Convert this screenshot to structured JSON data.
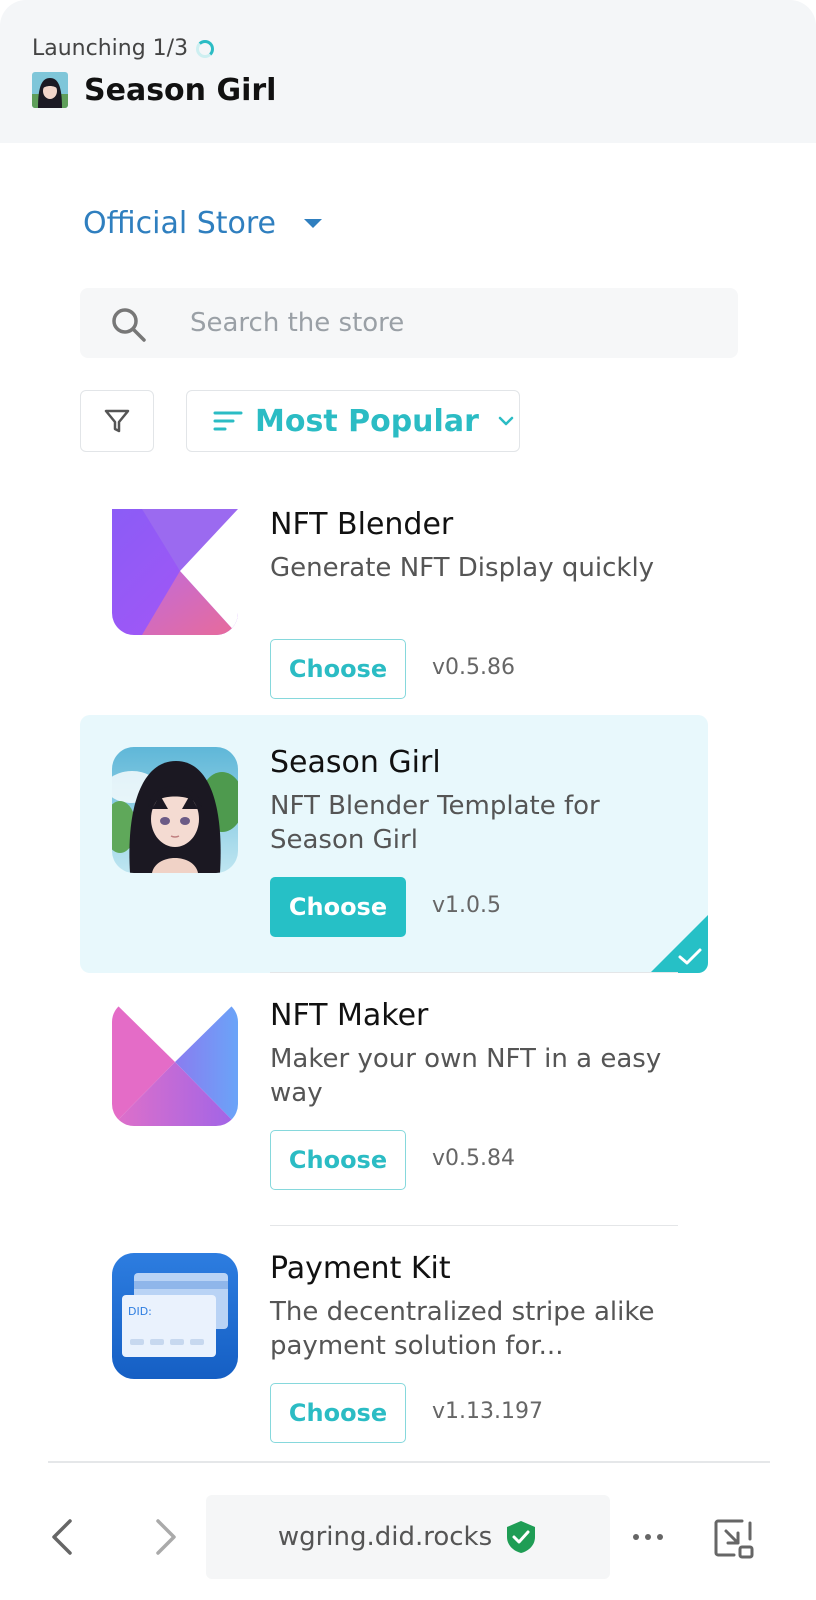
{
  "header": {
    "launching": "Launching 1/3",
    "title": "Season Girl"
  },
  "store": {
    "label": "Official Store"
  },
  "search": {
    "placeholder": "Search the store"
  },
  "sort": {
    "label": "Most Popular"
  },
  "items": [
    {
      "name": "NFT Blender",
      "desc": "Generate NFT Display quickly",
      "button": "Choose",
      "version": "v0.5.86",
      "icon": "nft-blender-icon",
      "selected": false
    },
    {
      "name": "Season Girl",
      "desc": "NFT Blender Template for Season Girl",
      "button": "Choose",
      "version": "v1.0.5",
      "icon": "season-girl-icon",
      "selected": true
    },
    {
      "name": "NFT Maker",
      "desc": "Maker your own NFT in a easy way",
      "button": "Choose",
      "version": "v0.5.84",
      "icon": "nft-maker-icon",
      "selected": false
    },
    {
      "name": "Payment Kit",
      "desc": "The decentralized stripe alike payment solution for...",
      "button": "Choose",
      "version": "v1.13.197",
      "icon": "payment-kit-icon",
      "icon_text": "DID:",
      "selected": false
    }
  ],
  "bottombar": {
    "url": "wgring.did.rocks"
  },
  "colors": {
    "accent": "#2bbcc4",
    "link": "#2f7fbf",
    "selected_bg": "#e8f8fc",
    "secure": "#1f9d55"
  }
}
